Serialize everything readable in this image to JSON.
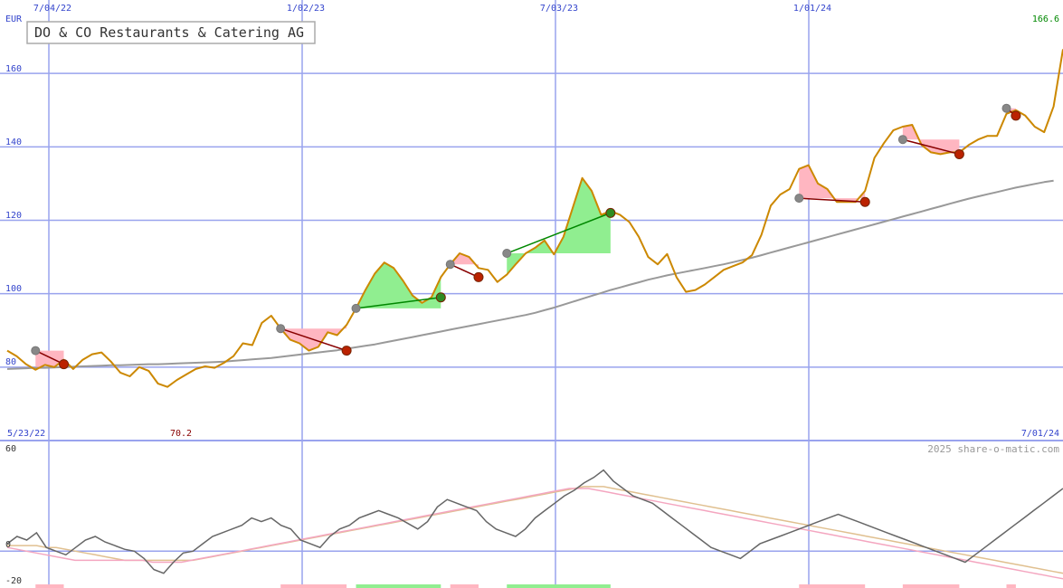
{
  "chart_data": [
    {
      "type": "line",
      "title": "DO & CO Restaurants & Catering AG",
      "ylabel": "EUR",
      "ylim": [
        60,
        180
      ],
      "yticks": [
        80,
        100,
        120,
        140,
        160
      ],
      "x_top_ticks": [
        "7/04/22",
        "1/02/23",
        "7/03/23",
        "1/01/24"
      ],
      "x_start_label": "5/23/22",
      "x_end_label": "7/01/24",
      "min_label": "70.2",
      "max_label": "166.6",
      "grid": true,
      "series": [
        {
          "values": [
            84.5,
            83,
            80.8,
            79.3,
            80.6,
            80,
            82,
            79.5,
            82,
            83.5,
            84,
            81.5,
            78.5,
            77.5,
            80,
            79,
            75.5,
            74.6,
            76.5,
            78,
            79.5,
            80.2,
            79.8,
            81.2,
            83,
            86.5,
            86,
            92,
            94,
            90.5,
            87.5,
            86.5,
            84.5,
            85.5,
            89.5,
            88.7,
            91.5,
            96,
            101,
            105.5,
            108.5,
            107,
            103.5,
            99.5,
            97.5,
            99,
            104.5,
            108,
            111,
            110,
            107,
            106.5,
            103.2,
            105.2,
            108.2,
            111,
            112.5,
            114.5,
            110.7,
            115.5,
            123.5,
            131.5,
            128,
            121.5,
            122.5,
            121.5,
            119.5,
            115.5,
            110,
            108,
            110.8,
            104.5,
            100.5,
            101,
            102.5,
            104.5,
            106.5,
            107.5,
            108.5,
            110.5,
            116,
            124,
            127,
            128.5,
            134,
            135,
            130,
            128.5,
            125,
            125,
            125,
            128,
            137,
            141,
            144.5,
            145.5,
            146,
            140.5,
            138.5,
            138,
            138.5,
            138.5,
            140.5,
            142,
            143,
            143,
            149,
            150,
            148.5,
            145.5,
            144,
            151,
            166.6
          ]
        },
        {
          "values": [
            79.5,
            79.6,
            79.7,
            79.8,
            79.8,
            79.9,
            80,
            80.1,
            80.2,
            80.3,
            80.4,
            80.5,
            80.5,
            80.6,
            80.7,
            80.8,
            80.8,
            80.9,
            81,
            81.1,
            81.2,
            81.3,
            81.4,
            81.5,
            81.7,
            81.9,
            82.1,
            82.3,
            82.5,
            82.8,
            83.1,
            83.4,
            83.7,
            84,
            84.3,
            84.6,
            85,
            85.4,
            85.8,
            86.2,
            86.7,
            87.2,
            87.7,
            88.2,
            88.7,
            89.2,
            89.7,
            90.2,
            90.7,
            91.2,
            91.7,
            92.2,
            92.7,
            93.2,
            93.7,
            94.2,
            94.8,
            95.5,
            96.2,
            97,
            97.8,
            98.6,
            99.4,
            100.2,
            101,
            101.7,
            102.4,
            103.1,
            103.8,
            104.4,
            105,
            105.5,
            106,
            106.5,
            107,
            107.5,
            108,
            108.6,
            109.2,
            109.8,
            110.5,
            111.2,
            111.9,
            112.6,
            113.3,
            114,
            114.7,
            115.4,
            116.1,
            116.8,
            117.5,
            118.2,
            118.9,
            119.6,
            120.3,
            121,
            121.7,
            122.4,
            123.1,
            123.8,
            124.5,
            125.2,
            125.9,
            126.5,
            127.1,
            127.7,
            128.3,
            128.9,
            129.4,
            129.9,
            130.4,
            130.8
          ]
        }
      ],
      "signals": [
        {
          "start": [
            3,
            84.5
          ],
          "end": [
            6,
            80.8
          ],
          "result": "loss"
        },
        {
          "start": [
            29,
            90.5
          ],
          "end": [
            36,
            84.5
          ],
          "result": "loss"
        },
        {
          "start": [
            37,
            96
          ],
          "end": [
            46,
            99
          ],
          "result": "gain"
        },
        {
          "start": [
            47,
            108
          ],
          "end": [
            50,
            104.5
          ],
          "result": "loss"
        },
        {
          "start": [
            53,
            111
          ],
          "end": [
            64,
            122
          ],
          "result": "gain"
        },
        {
          "start": [
            84,
            126
          ],
          "end": [
            91,
            125
          ],
          "result": "loss"
        },
        {
          "start": [
            95,
            142
          ],
          "end": [
            101,
            138
          ],
          "result": "loss"
        },
        {
          "start": [
            106,
            150.5
          ],
          "end": [
            107,
            148.5
          ],
          "result": "loss"
        }
      ]
    },
    {
      "type": "line",
      "ylim": [
        -20,
        60
      ],
      "yticks": [
        60,
        0,
        -20
      ],
      "copyright": "2025 share-o-matic.com",
      "series": [
        {
          "values": [
            4,
            8,
            6,
            10,
            2,
            0,
            -2,
            2,
            6,
            8,
            5,
            3,
            1,
            0,
            -4,
            -10,
            -12,
            -6,
            -1,
            0,
            4,
            8,
            10,
            12,
            14,
            18,
            16,
            18,
            14,
            12,
            6,
            4,
            2,
            8,
            12,
            14,
            18,
            20,
            22,
            20,
            18,
            15,
            12,
            16,
            24,
            28,
            26,
            24,
            22,
            16,
            12,
            10,
            8,
            12,
            18,
            22,
            26,
            30,
            33,
            37,
            40,
            44,
            38,
            34,
            30,
            28,
            26,
            22,
            18,
            14,
            10,
            6,
            2,
            0,
            -2,
            -4,
            0,
            4,
            6,
            8,
            10,
            12,
            14,
            16,
            18,
            20,
            18,
            16,
            14,
            12,
            10,
            8,
            6,
            4,
            2,
            0,
            -2,
            -4,
            -6,
            -2,
            2,
            6,
            10,
            14,
            18,
            22,
            26,
            30,
            34
          ]
        },
        {
          "values": [
            2,
            1,
            0,
            -1,
            -2,
            -3,
            -4,
            -5,
            -5,
            -5,
            -5,
            -5,
            -5,
            -5,
            -5,
            -6,
            -6,
            -6,
            -6,
            -5,
            -4,
            -3,
            -2,
            -1,
            0,
            1,
            2,
            3,
            4,
            5,
            6,
            7,
            8,
            9,
            10,
            11,
            12,
            13,
            14,
            15,
            16,
            17,
            18,
            19,
            20,
            21,
            22,
            23,
            24,
            25,
            26,
            27,
            28,
            29,
            30,
            31,
            32,
            33,
            34,
            34,
            34,
            33,
            32,
            31,
            30,
            29,
            28,
            27,
            26,
            25,
            24,
            23,
            22,
            21,
            20,
            19,
            18,
            17,
            16,
            15,
            14,
            13,
            12,
            11,
            10,
            9,
            8,
            7,
            6,
            5,
            4,
            3,
            2,
            1,
            0,
            -1,
            -2,
            -3,
            -4,
            -5,
            -6,
            -7,
            -8,
            -9,
            -10,
            -11,
            -12,
            -13,
            -14,
            -15
          ]
        },
        {
          "values": [
            3,
            3,
            3,
            3,
            2,
            2,
            1,
            0,
            -1,
            -2,
            -3,
            -4,
            -5,
            -5,
            -5,
            -5,
            -5,
            -5,
            -5,
            -5,
            -4,
            -3,
            -2,
            -1,
            0,
            1,
            2,
            3,
            4,
            5,
            6,
            7,
            8,
            9,
            10,
            11,
            12,
            13,
            14,
            15,
            16,
            17,
            18,
            19,
            20,
            21,
            22,
            23,
            24,
            25,
            26,
            27,
            28,
            29,
            30,
            31,
            32,
            33,
            34,
            35,
            35,
            35,
            34,
            33,
            32,
            31,
            30,
            29,
            28,
            27,
            26,
            25,
            24,
            23,
            22,
            21,
            20,
            19,
            18,
            17,
            16,
            15,
            14,
            13,
            12,
            11,
            10,
            9,
            8,
            7,
            6,
            5,
            4,
            3,
            2,
            1,
            0,
            -1,
            -2,
            -3,
            -4,
            -5,
            -6,
            -7,
            -8,
            -9,
            -10,
            -11,
            -12
          ]
        }
      ]
    }
  ],
  "colors": {
    "price": "#cc8800",
    "moving_average": "#999999",
    "gain_fill": "#90ee90",
    "loss_fill": "#ffb6c1",
    "gain_line": "#008800",
    "loss_line": "#880000",
    "grid": "#99a3ee",
    "osc_main": "#666666",
    "osc_fast": "#f4a6c0",
    "osc_slow": "#e0c090"
  }
}
